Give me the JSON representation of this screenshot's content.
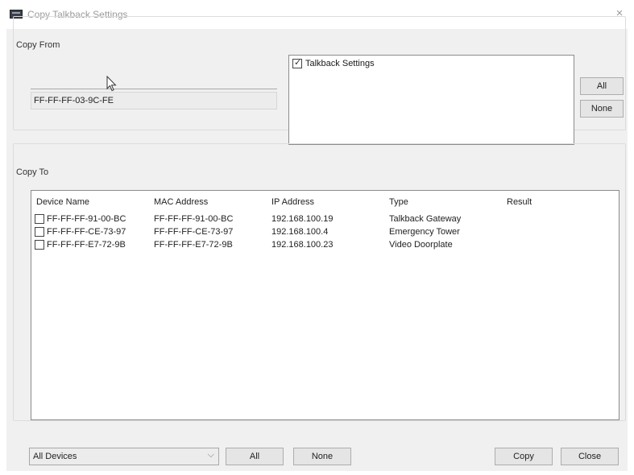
{
  "window": {
    "title": "Copy Talkback Settings",
    "close_glyph": "×"
  },
  "copy_from": {
    "label": "Copy From",
    "source_value": "FF-FF-FF-03-9C-FE",
    "settings": [
      {
        "label": "Talkback Settings",
        "checked": true
      }
    ],
    "all_label": "All",
    "none_label": "None"
  },
  "copy_to": {
    "label": "Copy To",
    "columns": [
      "Device Name",
      "MAC Address",
      "IP Address",
      "Type",
      "Result"
    ],
    "rows": [
      {
        "checked": false,
        "device_name": "FF-FF-FF-91-00-BC",
        "mac": "FF-FF-FF-91-00-BC",
        "ip": "192.168.100.19",
        "type": "Talkback Gateway",
        "result": ""
      },
      {
        "checked": false,
        "device_name": "FF-FF-FF-CE-73-97",
        "mac": "FF-FF-FF-CE-73-97",
        "ip": "192.168.100.4",
        "type": "Emergency Tower",
        "result": ""
      },
      {
        "checked": false,
        "device_name": "FF-FF-FF-E7-72-9B",
        "mac": "FF-FF-FF-E7-72-9B",
        "ip": "192.168.100.23",
        "type": "Video Doorplate",
        "result": ""
      }
    ]
  },
  "footer": {
    "filter_selected": "All Devices",
    "all_label": "All",
    "none_label": "None",
    "copy_label": "Copy",
    "close_label": "Close"
  },
  "icons": {
    "window_icon": "app-icon",
    "cursor": "mouse-cursor-icon"
  }
}
